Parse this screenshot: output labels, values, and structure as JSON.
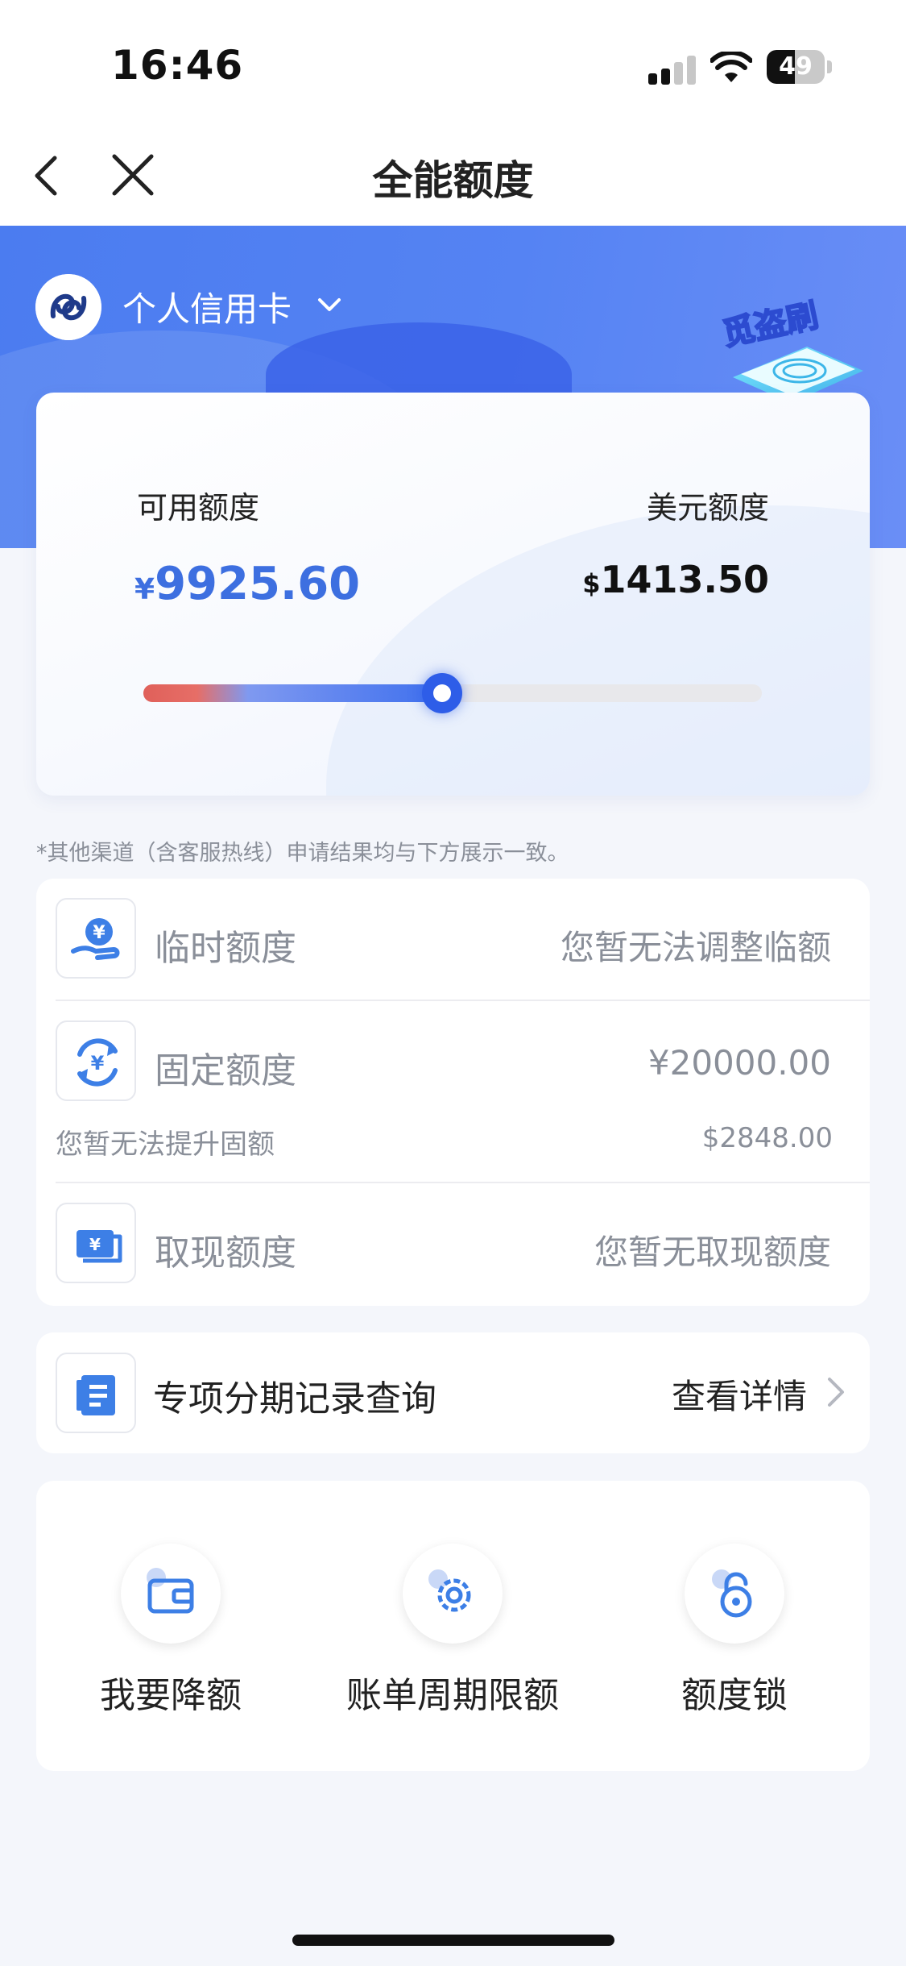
{
  "status_bar": {
    "time": "16:46",
    "battery": "49",
    "battery_level": 0.49
  },
  "nav": {
    "title": "全能额度",
    "back_icon": "chevron-left-icon",
    "close_icon": "close-icon"
  },
  "account": {
    "card_type": "个人信用卡",
    "badge_text": "觅盗刷"
  },
  "limits": {
    "available_label": "可用额度",
    "available_currency": "¥",
    "available_amount": "9925.60",
    "usd_label": "美元额度",
    "usd_currency": "$",
    "usd_amount": "1413.50",
    "usage_fraction": 0.483
  },
  "note": "*其他渠道（含客服热线）申请结果均与下方展示一致。",
  "limit_types": [
    {
      "icon": "yuan-hand-icon",
      "title": "临时额度",
      "value": "您暂无法调整临额"
    },
    {
      "icon": "yuan-cycle-icon",
      "title": "固定额度",
      "value": "¥20000.00",
      "sub_left": "您暂无法提升固额",
      "sub_right": "$2848.00"
    },
    {
      "icon": "cash-note-icon",
      "title": "取现额度",
      "value": "您暂无取现额度"
    }
  ],
  "record": {
    "icon": "document-icon",
    "title": "专项分期记录查询",
    "link": "查看详情"
  },
  "actions": [
    {
      "icon": "wallet-icon",
      "label": "我要降额"
    },
    {
      "icon": "gear-icon",
      "label": "账单周期限额"
    },
    {
      "icon": "lock-icon",
      "label": "额度锁"
    }
  ],
  "colors": {
    "accent": "#3d6fe0",
    "hero": "#4b7cf0",
    "slider_start": "#e0605a",
    "slider_end": "#3f70ee"
  }
}
